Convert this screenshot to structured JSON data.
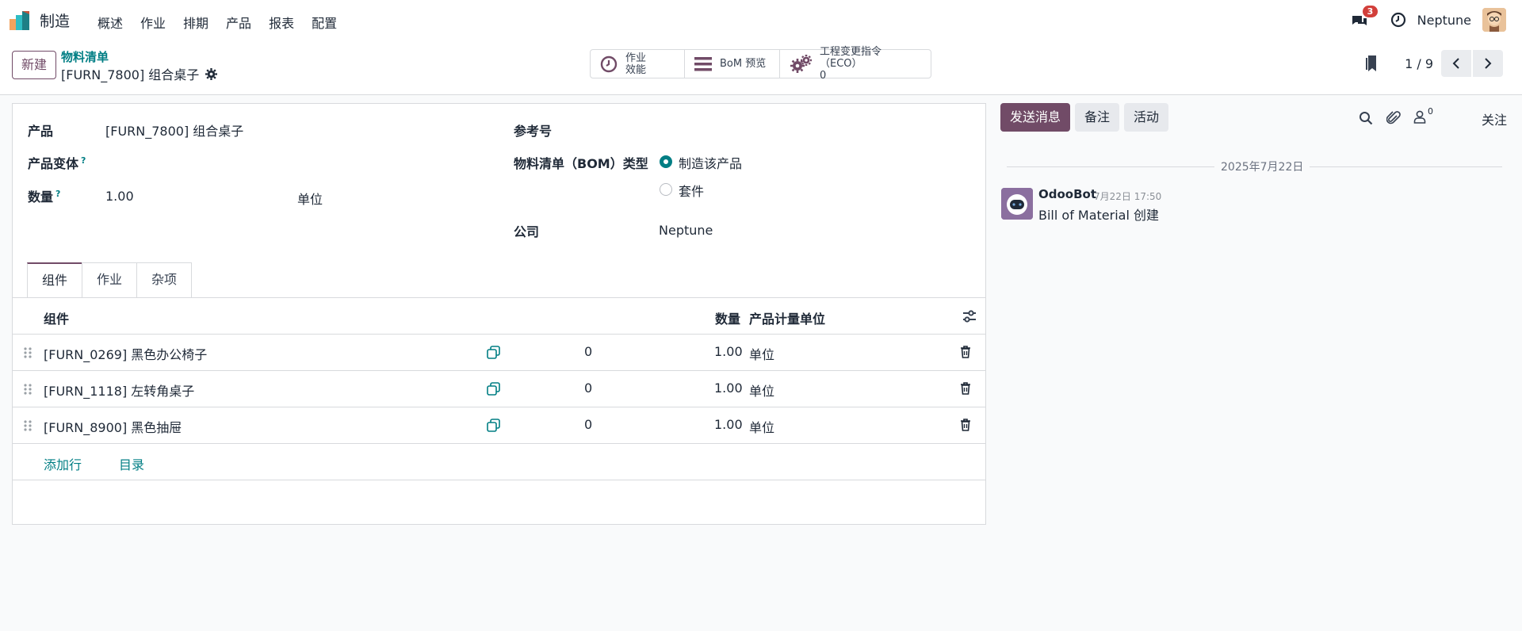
{
  "navbar": {
    "app_name": "制造",
    "menu": [
      "概述",
      "作业",
      "排期",
      "产品",
      "报表",
      "配置"
    ],
    "chat_badge": "3",
    "user_name": "Neptune",
    "icons": [
      "chat-icon",
      "clock-icon",
      "user-avatar"
    ]
  },
  "control": {
    "new_label": "新建",
    "breadcrumb_parent": "物料清单",
    "breadcrumb_current": "[FURN_7800] 组合桌子",
    "smart_buttons": [
      {
        "line1": "作业",
        "line2": "效能",
        "icon": "clock-icon"
      },
      {
        "line1": "BoM 预览",
        "line2": "",
        "icon": "list-icon"
      },
      {
        "line1": "工程变更指令（ECO）",
        "line2": "0",
        "icon": "gears-icon"
      }
    ],
    "pager": "1 / 9"
  },
  "form": {
    "product_label": "产品",
    "product_value": "[FURN_7800] 组合桌子",
    "variant_label": "产品变体",
    "qty_label": "数量",
    "qty_value": "1.00",
    "uom_value": "单位",
    "ref_label": "参考号",
    "bom_type_label": "物料清单（BOM）类型",
    "bom_type_options": [
      "制造该产品",
      "套件"
    ],
    "bom_type_selected": "制造该产品",
    "company_label": "公司",
    "company_value": "Neptune",
    "help_mark": "?"
  },
  "tabs": [
    "组件",
    "作业",
    "杂项"
  ],
  "table": {
    "headers": {
      "component": "组件",
      "qty": "数量",
      "uom": "产品计量单位"
    },
    "rows": [
      {
        "component": "[FURN_0269] 黑色办公椅子",
        "col2": "0",
        "qty": "1.00",
        "uom": "单位"
      },
      {
        "component": "[FURN_1118] 左转角桌子",
        "col2": "0",
        "qty": "1.00",
        "uom": "单位"
      },
      {
        "component": "[FURN_8900] 黑色抽屉",
        "col2": "0",
        "qty": "1.00",
        "uom": "单位"
      }
    ],
    "add_line": "添加行",
    "catalog": "目录"
  },
  "chatter": {
    "send_message": "发送消息",
    "log_note": "备注",
    "activity": "活动",
    "follower_count": "0",
    "follow": "关注",
    "date_separator": "2025年7月22日",
    "messages": [
      {
        "author": "OdooBot",
        "time": "7月22日 17:50",
        "body": "Bill of Material 创建"
      }
    ]
  },
  "colors": {
    "primary": "#714b67",
    "accent": "#017e84",
    "badge": "#d23f3a"
  }
}
